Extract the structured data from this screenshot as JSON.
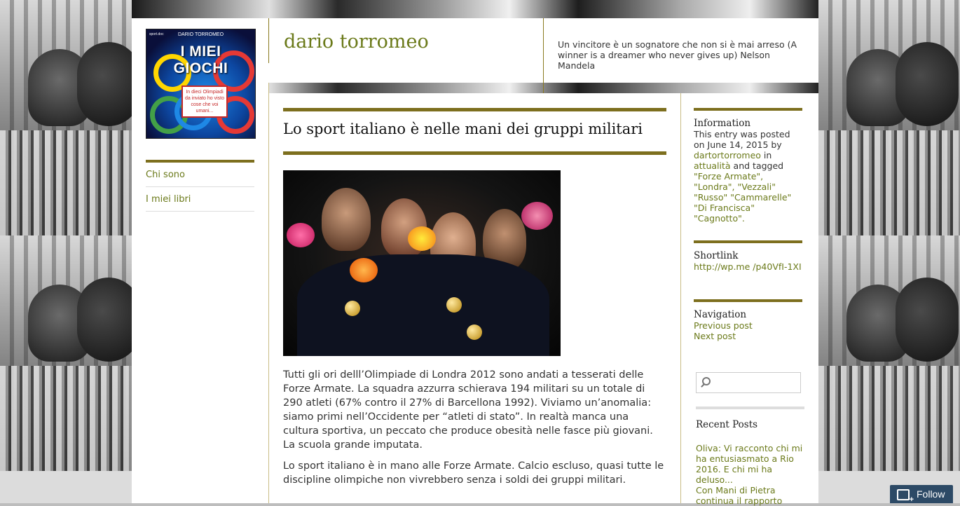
{
  "header": {
    "site_title": "dario torromeo",
    "tagline": "Un vincitore è un sognatore che non si è mai arreso (A winner is a dreamer who never gives up) Nelson Mandela"
  },
  "logo": {
    "author": "DARIO TORROMEO",
    "publisher": "sport.doc",
    "title_line1": "I MIEI",
    "title_line2": "GIOCHI",
    "note": "In dieci Olimpiadi da inviato ho visto cose che voi umani..."
  },
  "leftnav": {
    "items": [
      "Chi sono",
      "I miei libri"
    ]
  },
  "post": {
    "title": "Lo sport italiano è nelle mani dei gruppi militari",
    "paragraphs": [
      "Tutti gli ori delll’Olimpiade di Londra 2012 sono andati a tesserati delle Forze Armate. La squadra azzurra schierava 194 militari su un totale di 290 atleti (67% contro il 27% di Barcellona 1992). Viviamo un’anomalia: siamo primi nell’Occidente per “atleti di stato”. In realtà manca una cultura sportiva, un peccato che produce obesità nelle fasce più giovani. La scuola grande imputata.",
      "Lo sport italiano è in mano alle Forze Armate. Calcio escluso, quasi tutte le discipline olimpiche non vivrebbero senza i soldi dei gruppi militari."
    ]
  },
  "sidebar": {
    "information": {
      "heading": "Information",
      "text_pre": "This entry was posted on June 14, 2015 by",
      "author": "dartortorromeo",
      "in": "in",
      "category": "attualità",
      "tagged": "and tagged",
      "tags": "\"Forze Armate\", \"Londra\", \"Vezzali\" \"Russo\" \"Cammarelle\" \"Di Francisca\" \"Cagnotto\"."
    },
    "shortlink": {
      "heading": "Shortlink",
      "url": "http://wp.me /p40VfI-1XI"
    },
    "navigation": {
      "heading": "Navigation",
      "previous": "Previous post",
      "next": "Next post"
    },
    "search": {
      "placeholder": ""
    },
    "recent_posts": {
      "heading": "Recent Posts",
      "items": [
        "Oliva: Vi racconto chi mi ha entusiasmato a Rio 2016. E chi mi ha deluso...",
        "Con Mani di Pietra continua il rapporto"
      ]
    }
  },
  "follow": {
    "label": "Follow"
  },
  "colors": {
    "accent": "#7d6f1e",
    "link": "#6b7a1a",
    "follow_bg": "#2d4a66"
  }
}
